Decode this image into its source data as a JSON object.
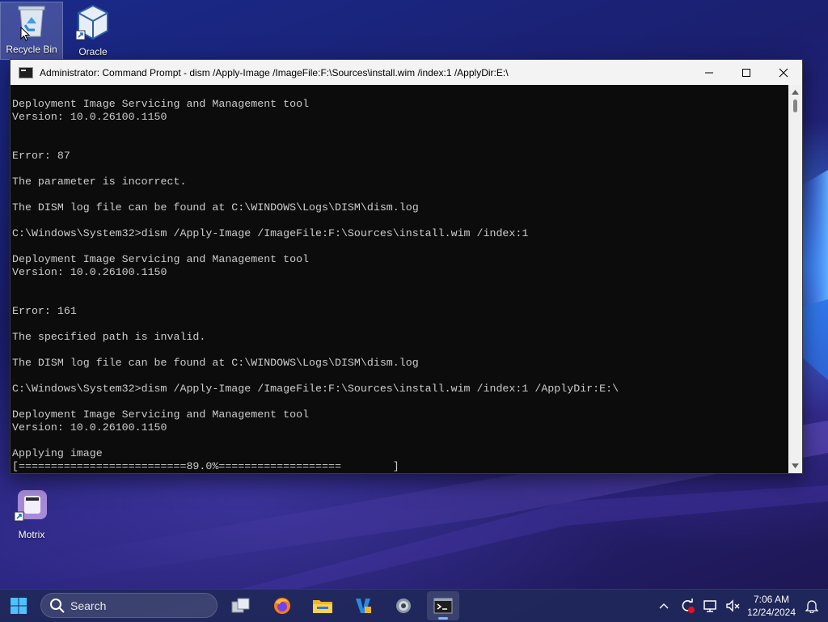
{
  "desktop": {
    "icons": [
      {
        "label": "Recycle Bin"
      },
      {
        "label": "Oracle"
      },
      {
        "label": "Motrix"
      }
    ]
  },
  "window": {
    "title": "Administrator: Command Prompt - dism  /Apply-Image /ImageFile:F:\\Sources\\install.wim /index:1 /ApplyDir:E:\\",
    "console_lines": [
      "Deployment Image Servicing and Management tool",
      "Version: 10.0.26100.1150",
      "",
      "",
      "Error: 87",
      "",
      "The parameter is incorrect.",
      "",
      "The DISM log file can be found at C:\\WINDOWS\\Logs\\DISM\\dism.log",
      "",
      "C:\\Windows\\System32>dism /Apply-Image /ImageFile:F:\\Sources\\install.wim /index:1",
      "",
      "Deployment Image Servicing and Management tool",
      "Version: 10.0.26100.1150",
      "",
      "",
      "Error: 161",
      "",
      "The specified path is invalid.",
      "",
      "The DISM log file can be found at C:\\WINDOWS\\Logs\\DISM\\dism.log",
      "",
      "C:\\Windows\\System32>dism /Apply-Image /ImageFile:F:\\Sources\\install.wim /index:1 /ApplyDir:E:\\",
      "",
      "Deployment Image Servicing and Management tool",
      "Version: 10.0.26100.1150",
      "",
      "Applying image",
      "[==========================89.0%===================        ]"
    ],
    "progress_percent": 89.0
  },
  "taskbar": {
    "search_placeholder": "Search",
    "apps": [
      "task-view",
      "firefox",
      "file-explorer",
      "visual-studio",
      "settings",
      "command-prompt"
    ],
    "clock": {
      "time": "7:06 AM",
      "date": "12/24/2024"
    }
  },
  "colors": {
    "console_bg": "#0c0c0c",
    "console_text": "#cccccc",
    "titlebar_bg": "#f3f3f3",
    "taskbar_bg": "#20285a",
    "accent": "#7fb8ff"
  }
}
